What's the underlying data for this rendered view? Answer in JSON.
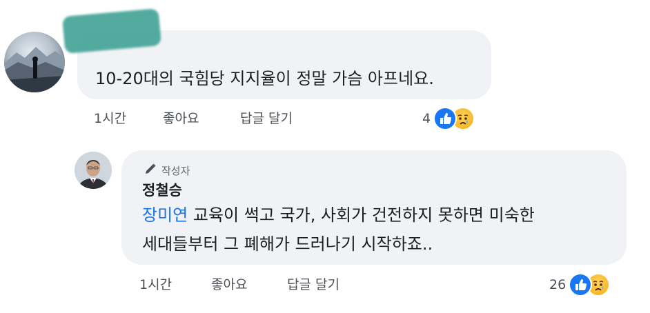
{
  "comments": [
    {
      "text": "10-20대의 국힘당 지지율이 정말 가슴 아프네요.",
      "time": "1시간",
      "like_label": "좋아요",
      "reply_label": "답글 달기",
      "reaction_count": "4"
    }
  ],
  "reply": {
    "badge": "작성자",
    "author": "정철승",
    "mention": "장미연",
    "line1_rest": " 교육이 썩고 국가, 사회가 건전하지 못하면 미숙한",
    "line2": "세대들부터 그 폐해가 드러나기 시작하죠..",
    "time": "1시간",
    "like_label": "좋아요",
    "reply_label": "답글 달기",
    "reaction_count": "26"
  },
  "icons": {
    "like": "like-icon",
    "sad": "sad-icon",
    "author_badge": "pencil-icon"
  },
  "colors": {
    "bubble": "#f0f2f5",
    "like_blue": "#1877f2",
    "mention_blue": "#1b74e4",
    "sad_yellow": "#f7b928",
    "redaction": "#4aa79b"
  }
}
